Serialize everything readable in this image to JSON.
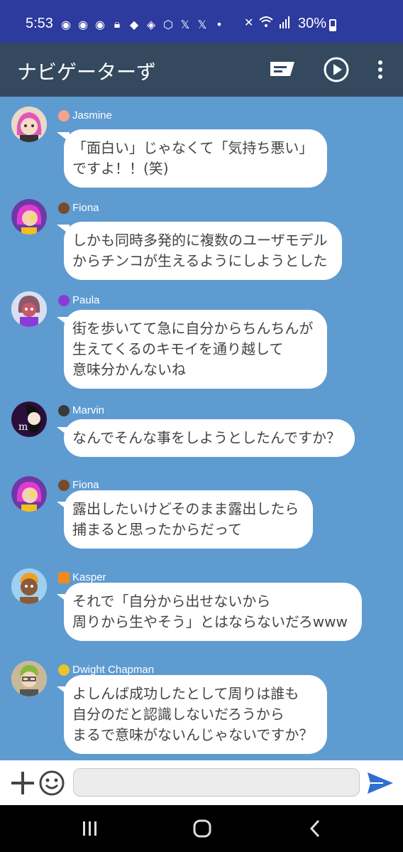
{
  "status_bar": {
    "time": "5:53",
    "battery": "30%",
    "notif_icons": [
      "discord-icon",
      "discord-icon",
      "discord-icon",
      "lock-icon",
      "app-icon",
      "app-icon",
      "cube-icon",
      "x-icon",
      "x-icon",
      "dot-icon"
    ],
    "sys_icons": [
      "mute-icon",
      "wifi-icon",
      "signal-icon"
    ]
  },
  "app_bar": {
    "title": "ナビゲーターず"
  },
  "messages": [
    {
      "sender": "Jasmine",
      "emoji_color": "#f6a38c",
      "text": "「面白い」じゃなくて「気持ち悪い」\nですよ！！(笑)"
    },
    {
      "sender": "Fiona",
      "emoji_color": "#7a4a2a",
      "text": "しかも同時多発的に複数のユーザモデル\nからチンコが生えるようにしようとした"
    },
    {
      "sender": "Paula",
      "emoji_color": "#8a3ad9",
      "text": "街を歩いてて急に自分からちんちんが\n生えてくるのキモイを通り越して\n意味分かんないね"
    },
    {
      "sender": "Marvin",
      "emoji_color": "#3a3a3a",
      "text": "なんでそんな事をしようとしたんですか？"
    },
    {
      "sender": "Fiona",
      "emoji_color": "#7a4a2a",
      "text": "露出したいけどそのまま露出したら\n捕まると思ったからだって"
    },
    {
      "sender": "Kasper",
      "emoji_color": "#f08a1c",
      "text": "それで「自分から出せないから\n周りから生やそう」とはならないだろwww"
    },
    {
      "sender": "Dwight Chapman",
      "emoji_color": "#e8c52a",
      "text": "よしんば成功したとして周りは誰も\n自分のだと認識しないだろうから\nまるで意味がないんじゃないですか？"
    }
  ],
  "input": {
    "placeholder": "",
    "value": ""
  },
  "colors": {
    "status_bar": "#2d3a9e",
    "app_bar": "#34495e",
    "chat_bg": "#5e9bd1",
    "send": "#2f6fd1"
  }
}
